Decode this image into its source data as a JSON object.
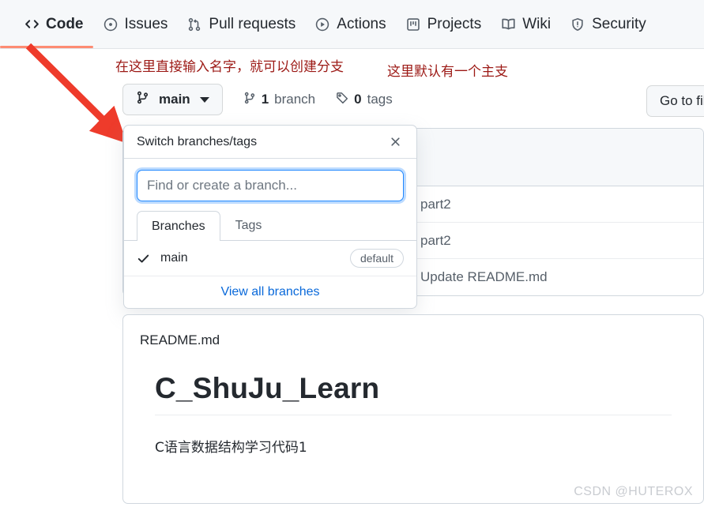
{
  "repo_nav": {
    "tabs": [
      {
        "label": "Code",
        "icon": "code-icon",
        "active": true
      },
      {
        "label": "Issues",
        "icon": "issue-opened-icon",
        "active": false
      },
      {
        "label": "Pull requests",
        "icon": "git-pull-request-icon",
        "active": false
      },
      {
        "label": "Actions",
        "icon": "play-icon",
        "active": false
      },
      {
        "label": "Projects",
        "icon": "project-icon",
        "active": false
      },
      {
        "label": "Wiki",
        "icon": "book-icon",
        "active": false
      },
      {
        "label": "Security",
        "icon": "shield-icon",
        "active": false
      }
    ]
  },
  "annotations": {
    "create_branch": "在这里直接输入名字，就可以创建分支",
    "default_branch": "这里默认有一个主支",
    "arrow_color": "#ee3b2b"
  },
  "toolbar": {
    "branch_button_label": "main",
    "branch_icon": "git-branch-icon",
    "branch_count": "1",
    "branch_count_label": "branch",
    "tag_count": "0",
    "tag_count_label": "tags",
    "tag_icon": "tag-icon",
    "go_to_file_label": "Go to file"
  },
  "file_list": {
    "rows": [
      {
        "message": "part2"
      },
      {
        "message": "part2"
      },
      {
        "message": "Update README.md"
      }
    ]
  },
  "branch_popover": {
    "title": "Switch branches/tags",
    "close_icon": "close-icon",
    "search_placeholder": "Find or create a branch...",
    "search_value": "",
    "tabs": [
      {
        "label": "Branches",
        "active": true
      },
      {
        "label": "Tags",
        "active": false
      }
    ],
    "branches": [
      {
        "name": "main",
        "checked": true,
        "badge": "default"
      }
    ],
    "view_all_label": "View all branches",
    "focus_color": "#2188ff",
    "link_color": "#0969da"
  },
  "readme": {
    "filename": "README.md",
    "heading": "C_ShuJu_Learn",
    "description": "C语言数据结构学习代码1"
  },
  "watermark": "CSDN @HUTEROX"
}
